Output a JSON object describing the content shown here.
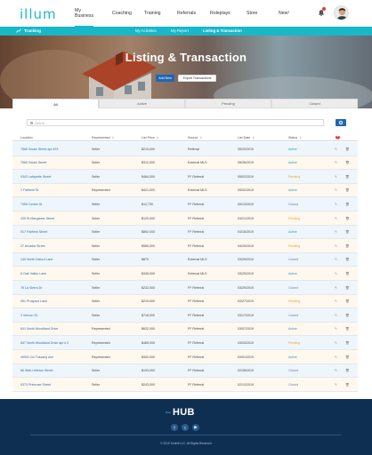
{
  "app": {
    "logo": "illum"
  },
  "nav": {
    "items": [
      {
        "label": "My Business",
        "active": true
      },
      {
        "label": "Coaching",
        "active": false
      },
      {
        "label": "Training",
        "active": false
      },
      {
        "label": "Referrals",
        "active": false
      },
      {
        "label": "Roleplays",
        "active": false
      },
      {
        "label": "Store",
        "active": false
      },
      {
        "label": "New!",
        "active": false
      }
    ],
    "bell_icon": "bell-icon",
    "avatar_icon": "user-avatar"
  },
  "subnav": {
    "section": "Tracking",
    "section_icon": "chart-line-icon",
    "links": [
      {
        "label": "My Activities",
        "active": false
      },
      {
        "label": "My Report",
        "active": false
      },
      {
        "label": "Listing & Transaction",
        "active": true
      }
    ],
    "accent": "#19b8c8"
  },
  "hero": {
    "title": "Listing & Transaction",
    "add_new": "Add New",
    "export": "Export Transactions"
  },
  "tabs": [
    {
      "label": "All",
      "active": true
    },
    {
      "label": "Active",
      "active": false
    },
    {
      "label": "Pending",
      "active": false
    },
    {
      "label": "Closed",
      "active": false
    }
  ],
  "search": {
    "placeholder": "Search"
  },
  "table": {
    "columns": [
      "Location",
      "Represented",
      "List Price",
      "Source",
      "List Date",
      "Status"
    ],
    "rows": [
      {
        "location": "7565 Swain Street apt #23",
        "represented": "Seller",
        "price": "$210,000",
        "source": "Referral",
        "date": "05/20/2019",
        "status": "Active"
      },
      {
        "location": "7565 Swain Street",
        "represented": "Seller",
        "price": "$312,000",
        "source": "External MLS",
        "date": "05/26/2019",
        "status": "Active"
      },
      {
        "location": "9343 Lafayette Street",
        "represented": "Seller",
        "price": "$464,000",
        "source": "FF Referral",
        "date": "05/02/2019",
        "status": "Pending"
      },
      {
        "location": "1 Fairfield St.",
        "represented": "Represented",
        "price": "$421,000",
        "source": "External MLS",
        "date": "05/02/2019",
        "status": "Active"
      },
      {
        "location": "7355 Center St",
        "represented": "Seller",
        "price": "$12,730",
        "source": "FF Referral",
        "date": "05/13/2019",
        "status": "Closed"
      },
      {
        "location": "435 St Margaretc Street",
        "represented": "Seller",
        "price": "$120,000",
        "source": "FF Referral",
        "date": "04/21/2019",
        "status": "Pending"
      },
      {
        "location": "917 Fairfield Street",
        "represented": "Seller",
        "price": "$892,000",
        "source": "FF Referral",
        "date": "04/18/2019",
        "status": "Active"
      },
      {
        "location": "27 Arcadia Street",
        "represented": "Seller",
        "price": "$565,000",
        "source": "FF Referral",
        "date": "04/20/2019",
        "status": "Pending"
      },
      {
        "location": "140 North Oxford Lane",
        "represented": "Seller",
        "price": "$879",
        "source": "External MLS",
        "date": "03/29/2019",
        "status": "Closed"
      },
      {
        "location": "8 Oak Valley Lane",
        "represented": "Seller",
        "price": "$345,000",
        "source": "External MLS",
        "date": "03/29/2019",
        "status": "Active"
      },
      {
        "location": "76 La Sierra Dr.",
        "represented": "Seller",
        "price": "$232,000",
        "source": "FF Referral",
        "date": "03/29/2019",
        "status": "Closed"
      },
      {
        "location": "951 Prospect Lane",
        "represented": "Seller",
        "price": "$219,000",
        "source": "FF Referral",
        "date": "03/27/2019",
        "status": "Pending"
      },
      {
        "location": "3 Vernon St.",
        "represented": "Seller",
        "price": "$718,000",
        "source": "FF Referral",
        "date": "03/17/2019",
        "status": "Closed"
      },
      {
        "location": "641 North Woodland Drive",
        "represented": "Represented",
        "price": "$622,000",
        "source": "FF Referral",
        "date": "03/07/2019",
        "status": "Active"
      },
      {
        "location": "647 North Woodland Drive apt # 2",
        "represented": "Represented",
        "price": "$489,000",
        "source": "FF Referral",
        "date": "03/03/2019",
        "status": "Pending"
      },
      {
        "location": "49991 Go Tuscany Ave",
        "represented": "Represented",
        "price": "$300,000",
        "source": "FF Referral",
        "date": "03/01/2019",
        "status": "Active"
      },
      {
        "location": "66 Web Littleton Street",
        "represented": "Seller",
        "price": "$193,000",
        "source": "FF Referral",
        "date": "02/28/2019",
        "status": "Closed"
      },
      {
        "location": "9373 Primrose Street",
        "represented": "Seller",
        "price": "$243,000",
        "source": "FF Referral",
        "date": "02/12/2019",
        "status": "Closed"
      }
    ]
  },
  "footer": {
    "hub_prefix": "illum",
    "hub": "HUB",
    "social": [
      "facebook-icon",
      "twitter-icon",
      "youtube-icon"
    ],
    "copyright": "© 2019 Tomhill LLC. All Rights Reserved"
  }
}
